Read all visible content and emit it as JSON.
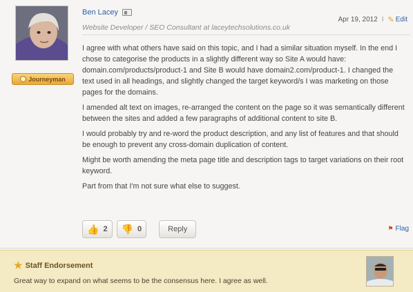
{
  "post": {
    "author": "Ben Lacey",
    "subtitle": "Website Developer / SEO Consultant at laceytechsolutions.co.uk",
    "date": "Apr 19, 2012",
    "separator": "I",
    "edit_label": "Edit",
    "rank_badge": "Journeyman",
    "paragraphs": [
      "I agree with what others have said on this topic, and I had a similar situation myself. In the end I chose to categorise the products in a slightly different way so Site A would have: domain.com/products/product-1 and Site B would have domain2.com/product-1. I changed the text used in all headings, and slightly changed the target keyword/s I was marketing on those pages for the domains.",
      "I amended alt text on images, re-arranged the content on the page so it was semantically different between the sites and added a few paragraphs of additional content to site B.",
      "I would probably try and re-word the product description, and any list of features and that should be enough to prevent any cross-domain duplication of content.",
      "Might be worth amending the meta page title and description tags to  target variations on their root keyword.",
      "Part from that I'm not sure what else to suggest."
    ],
    "thumbs_up_count": "2",
    "thumbs_down_count": "0",
    "reply_label": "Reply",
    "flag_label": "Flag"
  },
  "endorsement": {
    "title": "Staff Endorsement",
    "text": "Great way to expand on what seems to be the consensus here. I agree as well."
  },
  "colors": {
    "link": "#2f5fa8",
    "badge": "#e9a83a",
    "endorsement_bg": "#f4eac3"
  },
  "icons": {
    "vcard": "vcard-icon",
    "edit": "pencil-icon",
    "thumbs_up": "thumbs-up-icon",
    "thumbs_down": "thumbs-down-icon",
    "flag": "flag-icon",
    "star": "star-icon"
  }
}
